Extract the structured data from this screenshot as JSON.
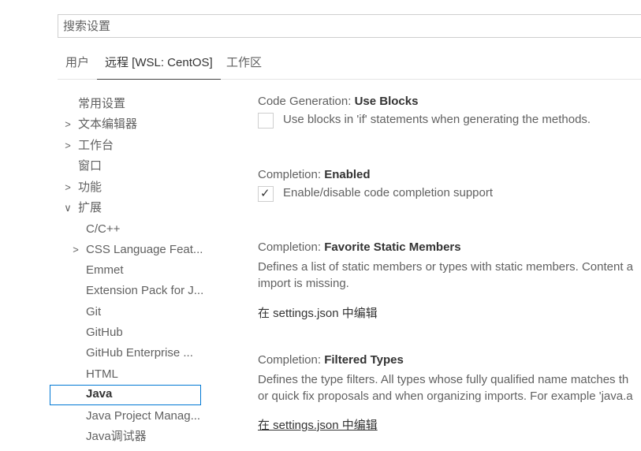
{
  "search": {
    "placeholder": "搜索设置"
  },
  "tabs": [
    {
      "label": "用户"
    },
    {
      "label": "远程 [WSL: CentOS]"
    },
    {
      "label": "工作区"
    }
  ],
  "toc": [
    {
      "label": "常用设置",
      "chevron": ""
    },
    {
      "label": "文本编辑器",
      "chevron": ">"
    },
    {
      "label": "工作台",
      "chevron": ">"
    },
    {
      "label": "窗口",
      "chevron": ""
    },
    {
      "label": "功能",
      "chevron": ">"
    },
    {
      "label": "扩展",
      "chevron": "∨"
    },
    {
      "label": "C/C++",
      "chevron": ""
    },
    {
      "label": "CSS Language Feat...",
      "chevron": ">"
    },
    {
      "label": "Emmet",
      "chevron": ""
    },
    {
      "label": "Extension Pack for J...",
      "chevron": ""
    },
    {
      "label": "Git",
      "chevron": ""
    },
    {
      "label": "GitHub",
      "chevron": ""
    },
    {
      "label": "GitHub Enterprise ...",
      "chevron": ""
    },
    {
      "label": "HTML",
      "chevron": ""
    },
    {
      "label": "Java",
      "chevron": ""
    },
    {
      "label": "Java Project Manag...",
      "chevron": ""
    },
    {
      "label": "Java调试器",
      "chevron": ""
    }
  ],
  "settings": {
    "use_blocks": {
      "category": "Code Generation: ",
      "name": "Use Blocks",
      "checkbox_label": "Use blocks in 'if' statements when generating the methods.",
      "checked": false
    },
    "completion_enabled": {
      "category": "Completion: ",
      "name": "Enabled",
      "checkbox_label": "Enable/disable code completion support",
      "checked": true,
      "check_glyph": "✓"
    },
    "favorite_static": {
      "category": "Completion: ",
      "name": "Favorite Static Members",
      "desc_line1": "Defines a list of static members or types with static members. Content a",
      "desc_line2": "import is missing.",
      "edit_link": "在 settings.json 中编辑"
    },
    "filtered_types": {
      "category": "Completion: ",
      "name": "Filtered Types",
      "desc_line1": "Defines the type filters. All types whose fully qualified name matches th",
      "desc_line2": "or quick fix proposals and when organizing imports. For example 'java.a",
      "edit_link": "在 settings.json 中编辑"
    }
  }
}
